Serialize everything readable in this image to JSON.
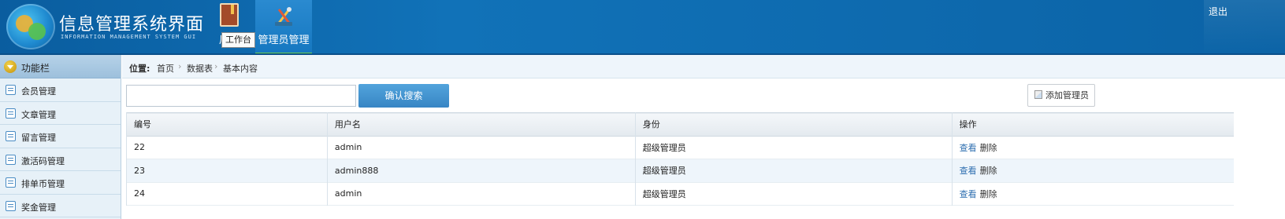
{
  "header": {
    "title": "信息管理系统界面",
    "subtitle": "INFORMATION MANAGEMENT SYSTEM GUI",
    "nav": [
      {
        "label": "后台",
        "icon": "book-icon"
      },
      {
        "label": "管理员管理",
        "icon": "tools-icon"
      }
    ],
    "tooltip": "工作台",
    "logout": "退出"
  },
  "sidebar": {
    "title": "功能栏",
    "items": [
      {
        "label": "会员管理",
        "icon": "list-icon"
      },
      {
        "label": "文章管理",
        "icon": "edit-icon"
      },
      {
        "label": "留言管理",
        "icon": "edit-icon"
      },
      {
        "label": "激活码管理",
        "icon": "calendar-icon"
      },
      {
        "label": "排单币管理",
        "icon": "calendar-icon"
      },
      {
        "label": "奖金管理",
        "icon": "calendar-icon"
      }
    ]
  },
  "breadcrumb": {
    "label": "位置:",
    "items": [
      "首页",
      "数据表",
      "基本内容"
    ],
    "separator": "›"
  },
  "search": {
    "value": "",
    "placeholder": "",
    "button": "确认搜索"
  },
  "add_button": "添加管理员",
  "table": {
    "headers": [
      "编号",
      "用户名",
      "身份",
      "操作"
    ],
    "rows": [
      {
        "id": "22",
        "username": "admin",
        "role": "超级管理员",
        "view": "查看",
        "delete": "删除"
      },
      {
        "id": "23",
        "username": "admin888",
        "role": "超级管理员",
        "view": "查看",
        "delete": "删除"
      },
      {
        "id": "24",
        "username": "admin",
        "role": "超级管理员",
        "view": "查看",
        "delete": "删除"
      }
    ]
  },
  "colors": {
    "header_bg": "#0b63a6",
    "nav_active": "#1577c0",
    "nav_underline": "#6dd04f",
    "sidebar_bg": "#e7f1f8",
    "button_blue": "#3785c4",
    "link_blue": "#2f6fb0"
  }
}
